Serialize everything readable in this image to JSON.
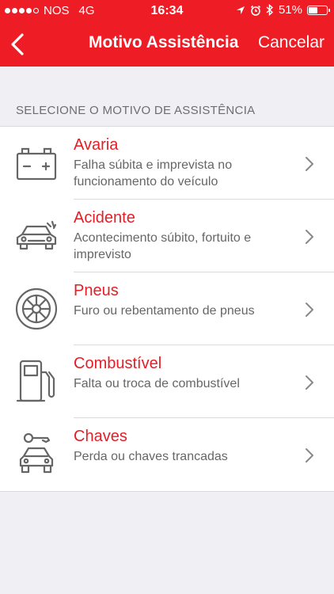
{
  "status_bar": {
    "carrier": "NOS",
    "network": "4G",
    "time": "16:34",
    "battery_pct": "51%",
    "battery_level": 0.51
  },
  "navbar": {
    "title": "Motivo Assistência",
    "cancel_label": "Cancelar",
    "color": "#ee1c25"
  },
  "section_header": "SELECIONE O MOTIVO DE ASSISTÊNCIA",
  "reasons": [
    {
      "title": "Avaria",
      "description": "Falha súbita e imprevista no funcionamento do veículo",
      "icon": "battery-icon"
    },
    {
      "title": "Acidente",
      "description": "Acontecimento súbito, fortuito e imprevisto",
      "icon": "car-crash-icon"
    },
    {
      "title": "Pneus",
      "description": "Furo ou rebentamento de pneus",
      "icon": "tire-icon"
    },
    {
      "title": "Combustível",
      "description": "Falta ou troca de combustível",
      "icon": "fuel-pump-icon"
    },
    {
      "title": "Chaves",
      "description": "Perda ou chaves trancadas",
      "icon": "car-key-icon"
    }
  ]
}
